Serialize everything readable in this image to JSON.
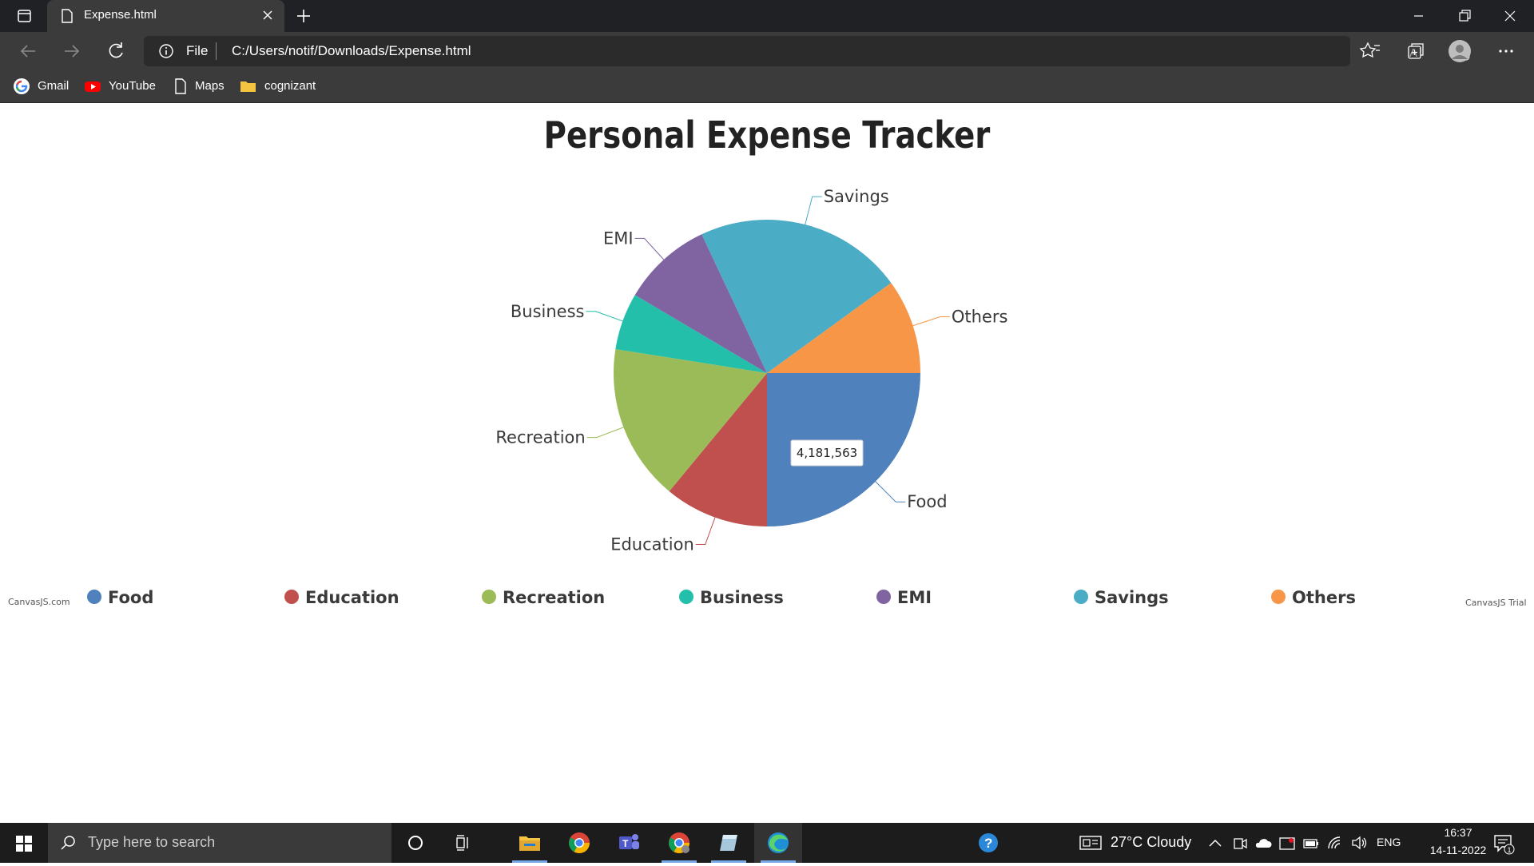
{
  "browser": {
    "tab_title": "Expense.html",
    "file_label": "File",
    "url": "C:/Users/notif/Downloads/Expense.html",
    "bookmarks": [
      {
        "label": "Gmail",
        "icon": "google-icon"
      },
      {
        "label": "YouTube",
        "icon": "youtube-icon"
      },
      {
        "label": "Maps",
        "icon": "page-icon"
      },
      {
        "label": "cognizant",
        "icon": "folder-icon"
      }
    ]
  },
  "page": {
    "credit_left": "CanvasJS.com",
    "credit_right": "CanvasJS Trial"
  },
  "chart_data": {
    "type": "pie",
    "title": "Personal Expense Tracker",
    "start_angle_deg": 0,
    "tooltip": {
      "slice": "Food",
      "text": "4,181,563"
    },
    "legend_position": "bottom",
    "slices": [
      {
        "label": "Food",
        "value": 25,
        "color": "#4f81bc"
      },
      {
        "label": "Education",
        "value": 11,
        "color": "#c0504e"
      },
      {
        "label": "Recreation",
        "value": 16.5,
        "color": "#9bbb58"
      },
      {
        "label": "Business",
        "value": 6,
        "color": "#23bfaa"
      },
      {
        "label": "EMI",
        "value": 9.5,
        "color": "#8064a1"
      },
      {
        "label": "Savings",
        "value": 22,
        "color": "#4aacc5"
      },
      {
        "label": "Others",
        "value": 10,
        "color": "#f79647"
      }
    ]
  },
  "taskbar": {
    "search_placeholder": "Type here to search",
    "weather": "27°C  Cloudy",
    "language": "ENG",
    "time": "16:37",
    "date": "14-11-2022",
    "notification_count": "1"
  }
}
